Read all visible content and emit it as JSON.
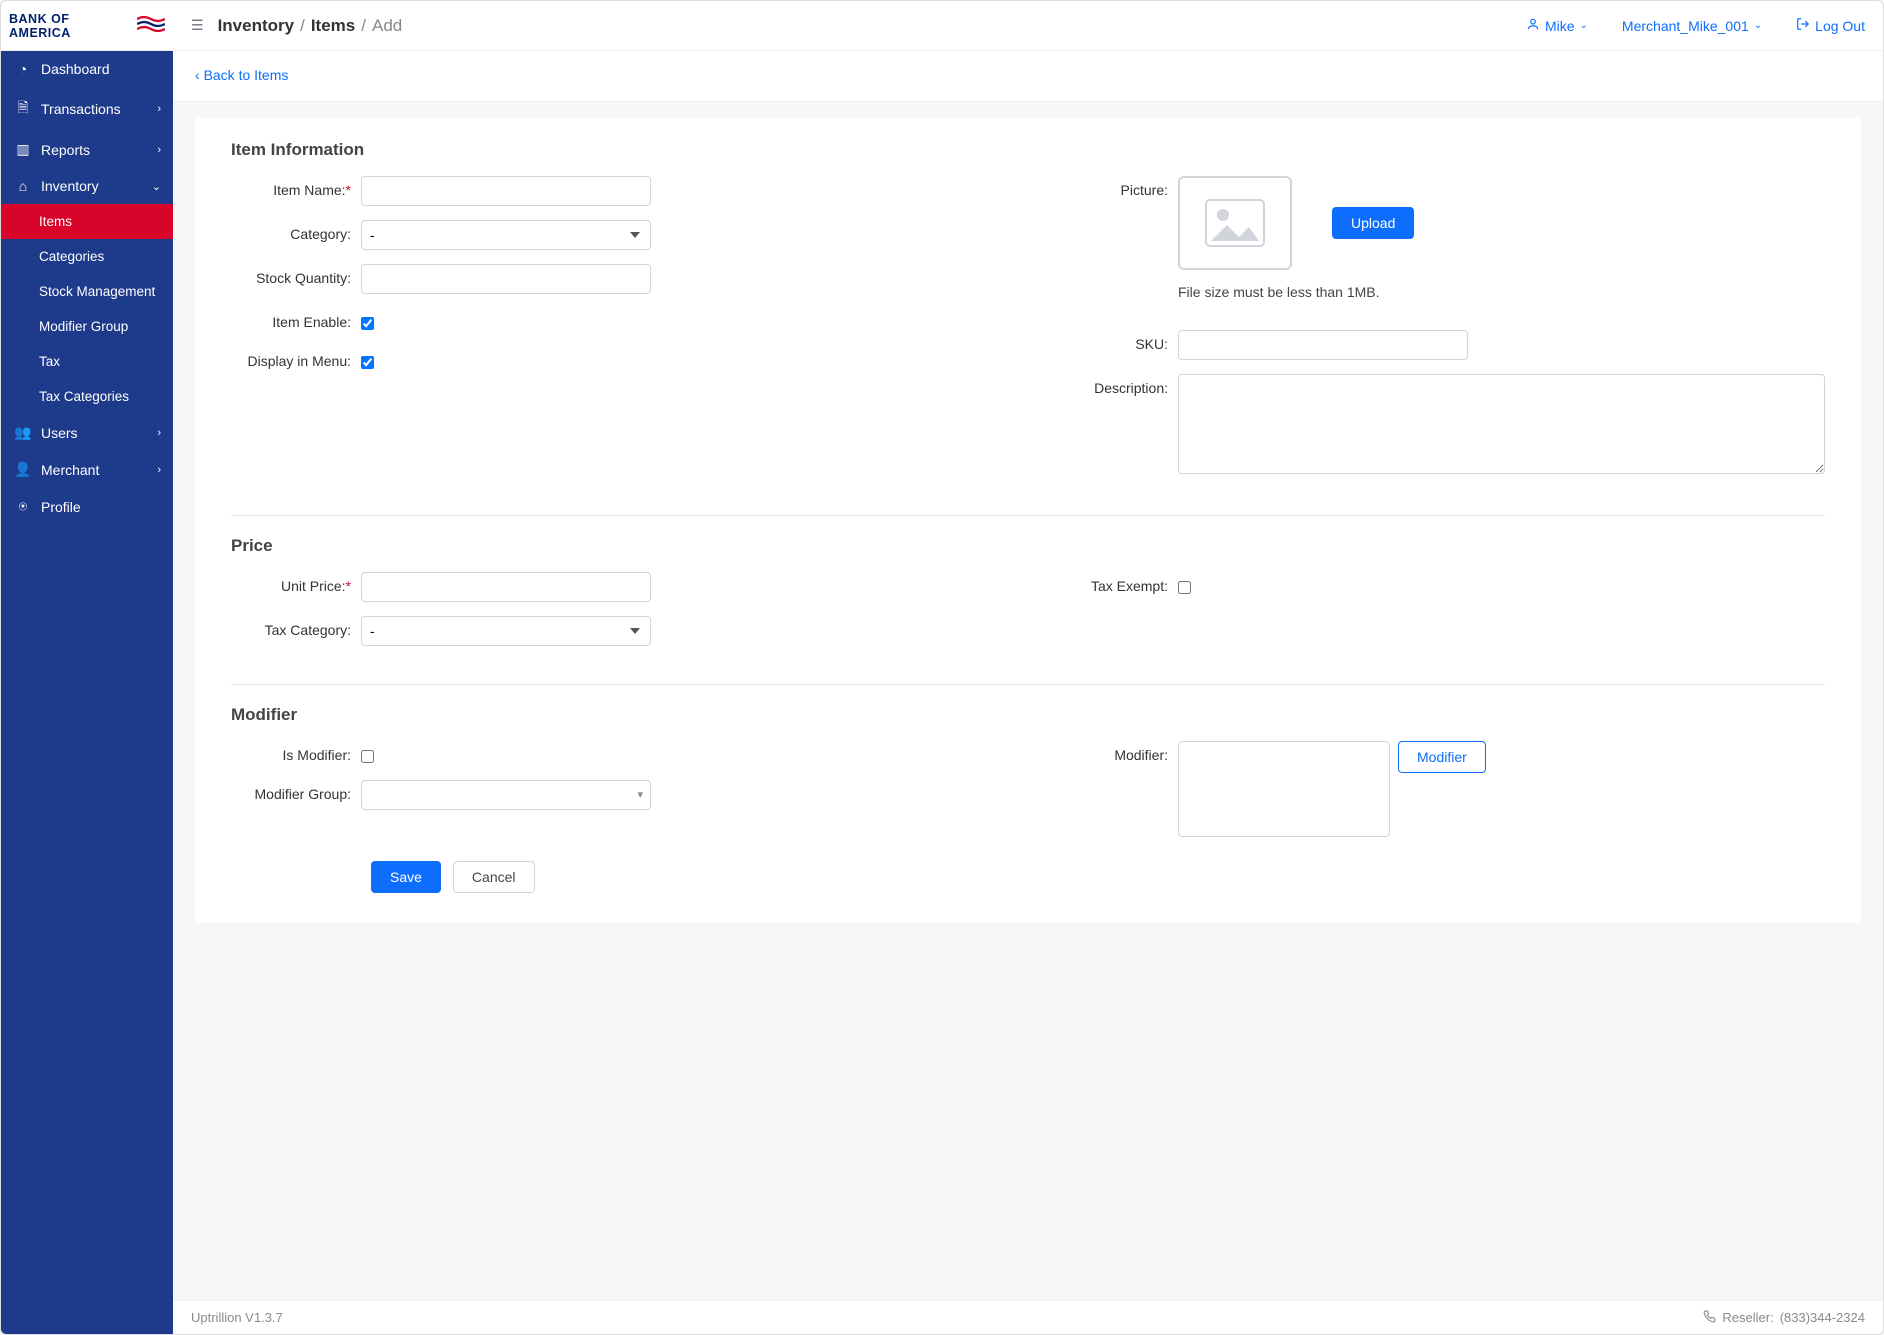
{
  "brand": "BANK OF AMERICA",
  "breadcrumb": {
    "a": "Inventory",
    "b": "Items",
    "c": "Add"
  },
  "header": {
    "user": "Mike",
    "merchant": "Merchant_Mike_001",
    "logout": "Log Out"
  },
  "back_link": "Back to Items",
  "sidebar": {
    "dashboard": "Dashboard",
    "transactions": "Transactions",
    "reports": "Reports",
    "inventory": "Inventory",
    "items": "Items",
    "categories": "Categories",
    "stock_mgmt": "Stock Management",
    "modifier_group": "Modifier Group",
    "tax": "Tax",
    "tax_categories": "Tax Categories",
    "users": "Users",
    "merchant": "Merchant",
    "profile": "Profile"
  },
  "sections": {
    "item_info": "Item Information",
    "price": "Price",
    "modifier": "Modifier"
  },
  "labels": {
    "item_name": "Item Name:",
    "category": "Category:",
    "stock_qty": "Stock Quantity:",
    "item_enable": "Item Enable:",
    "display_menu": "Display in Menu:",
    "picture": "Picture:",
    "upload": "Upload",
    "file_hint": "File size must be less than 1MB.",
    "sku": "SKU:",
    "description": "Description:",
    "unit_price": "Unit Price:",
    "tax_category": "Tax Category:",
    "tax_exempt": "Tax Exempt:",
    "is_modifier": "Is Modifier:",
    "modifier_group": "Modifier Group:",
    "modifier": "Modifier:",
    "modifier_btn": "Modifier",
    "save": "Save",
    "cancel": "Cancel"
  },
  "selects": {
    "category_selected": "-",
    "tax_category_selected": "-"
  },
  "footer": {
    "version": "Uptrillion V1.3.7",
    "reseller_label": "Reseller:",
    "reseller_phone": "(833)344-2324"
  }
}
